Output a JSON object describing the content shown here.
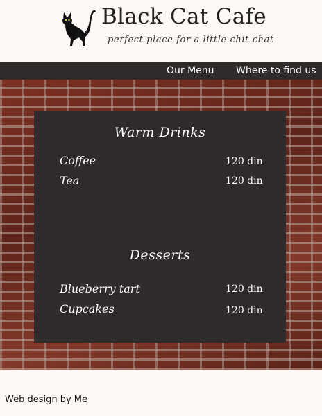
{
  "header": {
    "title": "Black Cat Cafe",
    "tagline": "perfect place for a little chit chat",
    "logo_icon": "black-cat-icon"
  },
  "nav": {
    "items": [
      {
        "label": "Our Menu"
      },
      {
        "label": "Where to find us"
      }
    ]
  },
  "menu": {
    "sections": [
      {
        "title": "Warm Drinks",
        "items": [
          {
            "name": "Coffee",
            "price": "120 din"
          },
          {
            "name": "Tea",
            "price": "120 din"
          }
        ]
      },
      {
        "title": "Desserts",
        "items": [
          {
            "name": "Blueberry tart",
            "price": "120 din"
          },
          {
            "name": "Cupcakes",
            "price": "120 din"
          }
        ]
      }
    ]
  },
  "footer": {
    "text": "Web design by Me"
  },
  "colors": {
    "page_background": "#fdf8f5",
    "nav_background": "#2f2b2b",
    "board_background": "#2f2b2b",
    "brick": "#6e2a20"
  }
}
